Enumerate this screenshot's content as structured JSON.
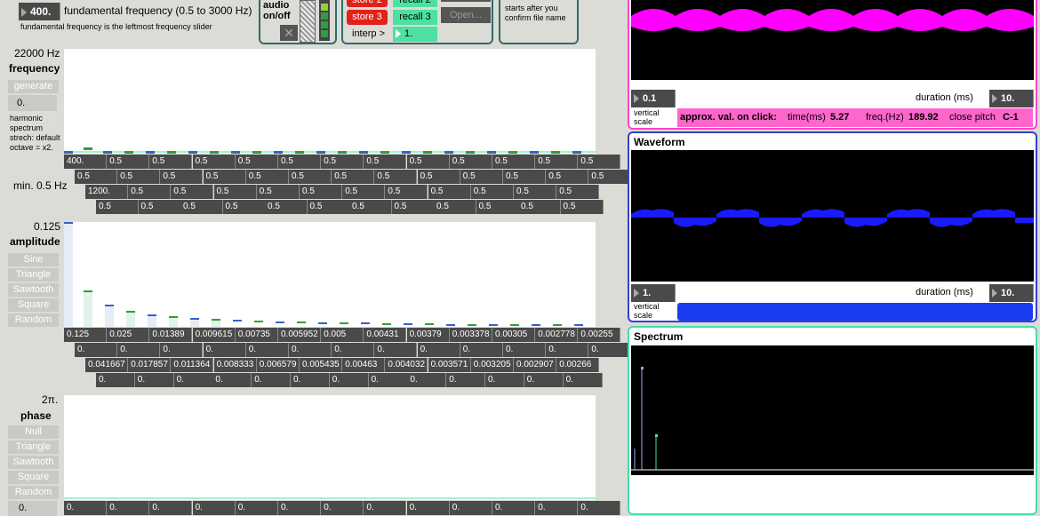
{
  "header": {
    "fund_value": "400.",
    "fund_title": "fundamental frequency (0.5 to 3000 Hz)",
    "fund_subtitle": "fundamental frequency is the leftmost frequency slider",
    "audio_label_1": "audio",
    "audio_label_2": "on/off",
    "store2": "store 2",
    "store3": "store 3",
    "recall2": "recall 2",
    "recall3": "recall 3",
    "interp": "interp >",
    "interp_value": "1.",
    "open": "Open...",
    "note_1": "starts after you",
    "note_2": "confirm file name"
  },
  "frequency": {
    "max": "22000 Hz",
    "title": "frequency",
    "generate": "generate",
    "stretch_value": "0.",
    "stretch_note": "harmonic spectrum strech: default octave = x2.",
    "min": "min. 0.5 Hz",
    "row1": [
      "400.",
      "0.5",
      "0.5",
      "0.5",
      "0.5",
      "0.5",
      "0.5",
      "0.5",
      "0.5",
      "0.5",
      "0.5",
      "0.5",
      "0.5"
    ],
    "row2": [
      "0.5",
      "0.5",
      "0.5",
      "0.5",
      "0.5",
      "0.5",
      "0.5",
      "0.5",
      "0.5",
      "0.5",
      "0.5",
      "0.5",
      "0.5"
    ],
    "row3": [
      "1200.",
      "0.5",
      "0.5",
      "0.5",
      "0.5",
      "0.5",
      "0.5",
      "0.5",
      "0.5",
      "0.5",
      "0.5",
      "0.5"
    ],
    "row4": [
      "0.5",
      "0.5",
      "0.5",
      "0.5",
      "0.5",
      "0.5",
      "0.5",
      "0.5",
      "0.5",
      "0.5",
      "0.5",
      "0.5"
    ]
  },
  "amplitude": {
    "max": "0.125",
    "title": "amplitude",
    "buttons": [
      "Sine",
      "Triangle",
      "Sawtooth",
      "Square",
      "Random"
    ],
    "row1": [
      "0.125",
      "0.025",
      "0.01389",
      "0.009615",
      "0.00735",
      "0.005952",
      "0.005",
      "0.00431",
      "0.00379",
      "0.003378",
      "0.00305",
      "0.002778",
      "0.00255"
    ],
    "row2": [
      "0.",
      "0.",
      "0.",
      "0.",
      "0.",
      "0.",
      "0.",
      "0.",
      "0.",
      "0.",
      "0.",
      "0.",
      "0."
    ],
    "row3": [
      "0.041667",
      "0.017857",
      "0.011364",
      "0.008333",
      "0.006579",
      "0.005435",
      "0.00463",
      "0.004032",
      "0.003571",
      "0.003205",
      "0.002907",
      "0.00266"
    ],
    "row4": [
      "0.",
      "0.",
      "0.",
      "0.",
      "0.",
      "0.",
      "0.",
      "0.",
      "0.",
      "0.",
      "0.",
      "0.",
      "0."
    ]
  },
  "phase": {
    "max": "2π.",
    "title": "phase",
    "buttons": [
      "Null",
      "Triangle",
      "Sawtooth",
      "Square",
      "Random"
    ],
    "value": "0.",
    "row1": [
      "0.",
      "0.",
      "0.",
      "0.",
      "0.",
      "0.",
      "0.",
      "0.",
      "0.",
      "0.",
      "0.",
      "0.",
      "0."
    ]
  },
  "scope_top": {
    "vscale": "0.1",
    "vscale_label": "vertical scale",
    "duration_label": "duration (ms)",
    "duration": "10.",
    "approx_label": "approx. val. on click:",
    "time_label": "time(ms)",
    "time": "5.27",
    "freq_label": "freq.(Hz)",
    "freq": "189.92",
    "pitch_label": "close pitch",
    "pitch": "C-1",
    "color": "#ff00ff"
  },
  "waveform": {
    "title": "Waveform",
    "vscale": "1.",
    "vscale_label": "vertical scale",
    "duration_label": "duration (ms)",
    "duration": "10.",
    "color": "#1a1aff"
  },
  "spectrum": {
    "title": "Spectrum",
    "color": "#33ddaa"
  }
}
